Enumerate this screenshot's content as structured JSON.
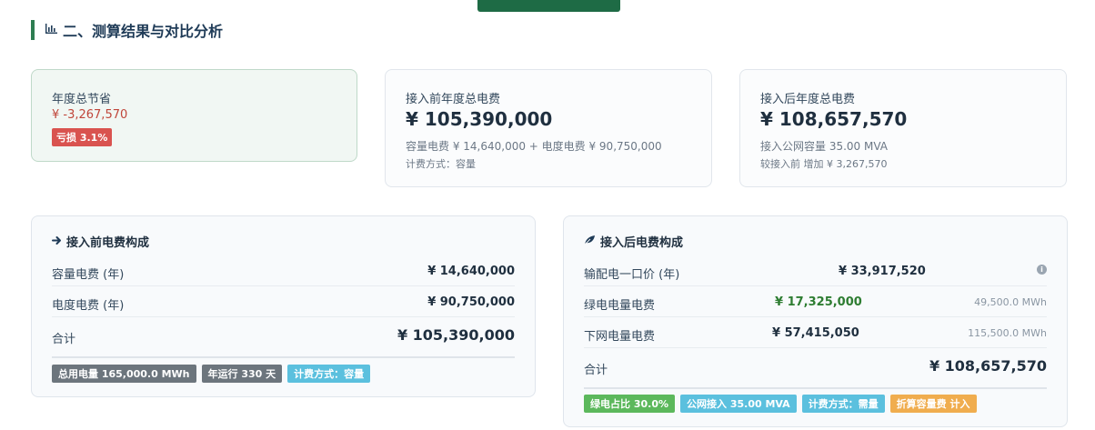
{
  "section": {
    "icon": "bar-chart-icon",
    "title": "二、测算结果与对比分析"
  },
  "summary": {
    "saving": {
      "label": "年度总节省",
      "amount": "¥ -3,267,570",
      "badge": "亏损 3.1%"
    },
    "before": {
      "label": "接入前年度总电费",
      "amount": "¥ 105,390,000",
      "detail": "容量电费 ¥ 14,640,000 + 电度电费 ¥ 90,750,000",
      "method": "计费方式：容量"
    },
    "after": {
      "label": "接入后年度总电费",
      "amount": "¥ 108,657,570",
      "detail": "接入公网容量 35.00 MVA",
      "compare": "较接入前 增加 ¥ 3,267,570"
    }
  },
  "before_detail": {
    "icon": "arrow-right-icon",
    "title": "接入前电费构成",
    "rows": [
      {
        "label": "容量电费 (年)",
        "value": "¥ 14,640,000"
      },
      {
        "label": "电度电费 (年)",
        "value": "¥ 90,750,000"
      }
    ],
    "total_label": "合计",
    "total_value": "¥ 105,390,000",
    "tags": [
      "总用电量 165,000.0 MWh",
      "年运行 330 天",
      "计费方式：容量"
    ]
  },
  "after_detail": {
    "icon": "leaf-icon",
    "title": "接入后电费构成",
    "rows": [
      {
        "label": "输配电一口价 (年)",
        "value": "¥ 33,917,520",
        "unit": ""
      },
      {
        "label": "绿电电量电费",
        "value": "¥ 17,325,000",
        "unit": "49,500.0 MWh"
      },
      {
        "label": "下网电量电费",
        "value": "¥ 57,415,050",
        "unit": "115,500.0 MWh"
      }
    ],
    "total_label": "合计",
    "total_value": "¥ 108,657,570",
    "tags": [
      "绿电占比 30.0%",
      "公网接入 35.00 MVA",
      "计费方式：需量",
      "折算容量费 计入"
    ]
  },
  "colors": {
    "accent": "#2e7d52",
    "loss": "#d9534f",
    "green_value": "#2e7d32"
  }
}
